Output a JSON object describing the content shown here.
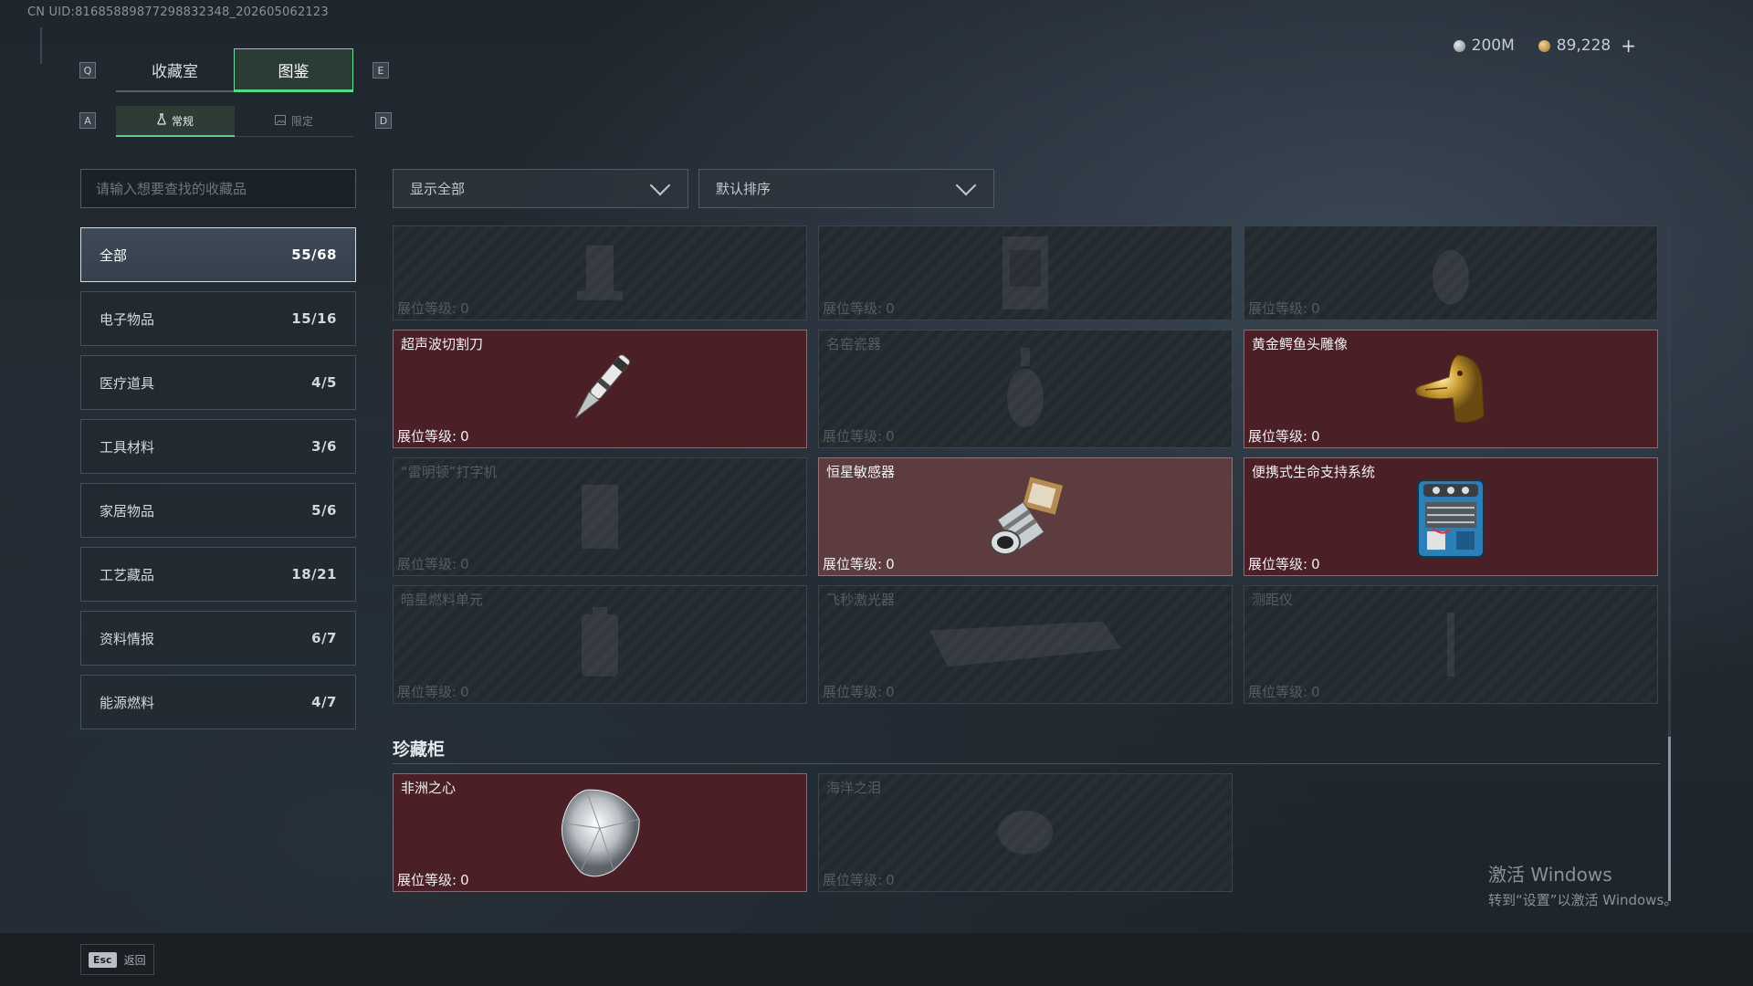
{
  "uid": "CN UID:8168588987729883234​8_202605062123",
  "hotkeys": {
    "prev_tab": "Q",
    "next_tab": "E",
    "prev_sub": "A",
    "next_sub": "D"
  },
  "tabs": [
    {
      "label": "收藏室",
      "active": false
    },
    {
      "label": "图鉴",
      "active": true
    }
  ],
  "subtabs": [
    {
      "label": "常规",
      "icon": "flask-icon",
      "active": true
    },
    {
      "label": "限定",
      "icon": "image-icon",
      "active": false
    }
  ],
  "currency": {
    "silver": "200M",
    "gold": "89,228",
    "add": "+"
  },
  "search": {
    "placeholder": "请输入想要查找的收藏品"
  },
  "categories": [
    {
      "label": "全部",
      "count": "55/68",
      "active": true
    },
    {
      "label": "电子物品",
      "count": "15/16"
    },
    {
      "label": "医疗道具",
      "count": "4/5"
    },
    {
      "label": "工具材料",
      "count": "3/6"
    },
    {
      "label": "家居物品",
      "count": "5/6"
    },
    {
      "label": "工艺藏品",
      "count": "18/21"
    },
    {
      "label": "资料情报",
      "count": "6/7"
    },
    {
      "label": "能源燃料",
      "count": "4/7"
    }
  ],
  "filters": {
    "show": "显示全部",
    "sort": "默认排序"
  },
  "level_label": "展位等级:",
  "cards": [
    {
      "name": "",
      "level": "0",
      "icon": "lamp-icon",
      "owned": false
    },
    {
      "name": "",
      "level": "0",
      "icon": "cabinet-icon",
      "owned": false
    },
    {
      "name": "",
      "level": "0",
      "icon": "vase-icon",
      "owned": false
    },
    {
      "name": "超声波切割刀",
      "level": "0",
      "icon": "scalpel-icon",
      "owned": true
    },
    {
      "name": "名窑瓷器",
      "level": "0",
      "icon": "porcelain-vase-icon",
      "owned": false
    },
    {
      "name": "黄金鳄鱼头雕像",
      "level": "0",
      "icon": "golden-crocodile-icon",
      "owned": true
    },
    {
      "name": "“雷明顿”打字机",
      "level": "0",
      "icon": "typewriter-icon",
      "owned": false
    },
    {
      "name": "恒星敏感器",
      "level": "0",
      "icon": "star-sensor-icon",
      "owned": true
    },
    {
      "name": "便携式生命支持系统",
      "level": "0",
      "icon": "life-support-icon",
      "owned": true
    },
    {
      "name": "暗星燃料单元",
      "level": "0",
      "icon": "fuel-cell-icon",
      "owned": false
    },
    {
      "name": "飞秒激光器",
      "level": "0",
      "icon": "laser-box-icon",
      "owned": false
    },
    {
      "name": "测距仪",
      "level": "0",
      "icon": "rangefinder-icon",
      "owned": false
    }
  ],
  "section": {
    "title": "珍藏柜"
  },
  "treasures": [
    {
      "name": "非洲之心",
      "level": "0",
      "icon": "diamond-icon",
      "owned": true
    },
    {
      "name": "海洋之泪",
      "level": "0",
      "icon": "gem-icon",
      "owned": false
    }
  ],
  "footer": {
    "esc": "Esc",
    "back": "返回"
  },
  "watermark": {
    "line1": "激活 Windows",
    "line2": "转到“设置”以激活 Windows。"
  },
  "colors": {
    "accent_green": "#58d68b",
    "owned_card": "#4a2026",
    "owned_card_light": "#5c3c3f"
  }
}
